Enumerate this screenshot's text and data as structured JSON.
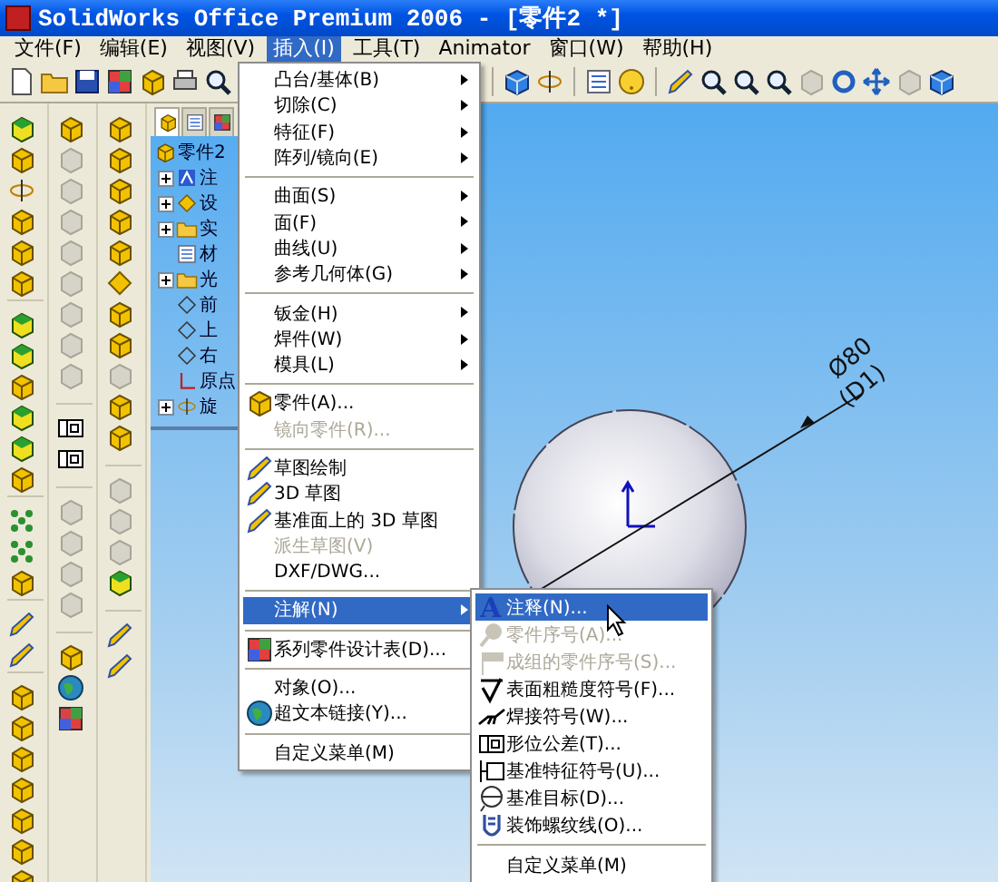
{
  "window": {
    "title": "SolidWorks Office Premium 2006 - [零件2 *]"
  },
  "menu_bar": [
    {
      "label": "文件(F)",
      "selected": false
    },
    {
      "label": "编辑(E)",
      "selected": false
    },
    {
      "label": "视图(V)",
      "selected": false
    },
    {
      "label": "插入(I)",
      "selected": true
    },
    {
      "label": "工具(T)",
      "selected": false
    },
    {
      "label": "Animator",
      "selected": false
    },
    {
      "label": "窗口(W)",
      "selected": false
    },
    {
      "label": "帮助(H)",
      "selected": false
    }
  ],
  "tree": {
    "tabs": [
      {
        "selected": true
      },
      {
        "selected": false
      },
      {
        "selected": false
      }
    ],
    "root": {
      "label": "零件2",
      "children": [
        {
          "label": "注",
          "expandable": true
        },
        {
          "label": "设",
          "expandable": true
        },
        {
          "label": "实",
          "expandable": true
        },
        {
          "label": "材",
          "expandable": false
        },
        {
          "label": "光",
          "expandable": true
        },
        {
          "label": "前",
          "expandable": false
        },
        {
          "label": "上",
          "expandable": false
        },
        {
          "label": "右",
          "expandable": false
        },
        {
          "label": "原点",
          "expandable": false
        },
        {
          "label": "旋",
          "expandable": true
        }
      ]
    }
  },
  "graphics": {
    "dimension": {
      "value": "Ø80",
      "name": "(D1)"
    }
  },
  "insert_menu": {
    "groups": [
      [
        {
          "label": "凸台/基体(B)",
          "submenu": true,
          "disabled": false,
          "selected": false
        },
        {
          "label": "切除(C)",
          "submenu": true,
          "disabled": false,
          "selected": false
        },
        {
          "label": "特征(F)",
          "submenu": true,
          "disabled": false,
          "selected": false
        },
        {
          "label": "阵列/镜向(E)",
          "submenu": true,
          "disabled": false,
          "selected": false
        }
      ],
      [
        {
          "label": "曲面(S)",
          "submenu": true,
          "disabled": false,
          "selected": false
        },
        {
          "label": "面(F)",
          "submenu": true,
          "disabled": false,
          "selected": false
        },
        {
          "label": "曲线(U)",
          "submenu": true,
          "disabled": false,
          "selected": false
        },
        {
          "label": "参考几何体(G)",
          "submenu": true,
          "disabled": false,
          "selected": false
        }
      ],
      [
        {
          "label": "钣金(H)",
          "submenu": true,
          "disabled": false,
          "selected": false
        },
        {
          "label": "焊件(W)",
          "submenu": true,
          "disabled": false,
          "selected": false
        },
        {
          "label": "模具(L)",
          "submenu": true,
          "disabled": false,
          "selected": false
        }
      ],
      [
        {
          "label": "零件(A)...",
          "submenu": false,
          "disabled": false,
          "selected": false
        },
        {
          "label": "镜向零件(R)...",
          "submenu": false,
          "disabled": true,
          "selected": false
        }
      ],
      [
        {
          "label": "草图绘制",
          "submenu": false,
          "disabled": false,
          "selected": false
        },
        {
          "label": "3D 草图",
          "submenu": false,
          "disabled": false,
          "selected": false
        },
        {
          "label": "基准面上的 3D 草图",
          "submenu": false,
          "disabled": false,
          "selected": false
        },
        {
          "label": "派生草图(V)",
          "submenu": false,
          "disabled": true,
          "selected": false
        },
        {
          "label": "DXF/DWG...",
          "submenu": false,
          "disabled": false,
          "selected": false
        }
      ],
      [
        {
          "label": "注解(N)",
          "submenu": true,
          "disabled": false,
          "selected": true
        }
      ],
      [
        {
          "label": "系列零件设计表(D)...",
          "submenu": false,
          "disabled": false,
          "selected": false
        }
      ],
      [
        {
          "label": "对象(O)...",
          "submenu": false,
          "disabled": false,
          "selected": false
        },
        {
          "label": "超文本链接(Y)...",
          "submenu": false,
          "disabled": false,
          "selected": false
        }
      ],
      [
        {
          "label": "自定义菜单(M)",
          "submenu": false,
          "disabled": false,
          "selected": false
        }
      ]
    ]
  },
  "annotation_submenu": {
    "groups": [
      [
        {
          "label": "注释(N)...",
          "icon_text": "A",
          "disabled": false,
          "selected": true
        },
        {
          "label": "零件序号(A)...",
          "disabled": true,
          "selected": false
        },
        {
          "label": "成组的零件序号(S)...",
          "disabled": true,
          "selected": false
        },
        {
          "label": "表面粗糙度符号(F)...",
          "disabled": false,
          "selected": false
        },
        {
          "label": "焊接符号(W)...",
          "disabled": false,
          "selected": false
        },
        {
          "label": "形位公差(T)...",
          "disabled": false,
          "selected": false
        },
        {
          "label": "基准特征符号(U)...",
          "disabled": false,
          "selected": false
        },
        {
          "label": "基准目标(D)...",
          "disabled": false,
          "selected": false
        },
        {
          "label": "装饰螺纹线(O)...",
          "disabled": false,
          "selected": false
        }
      ],
      [
        {
          "label": "自定义菜单(M)",
          "disabled": false,
          "selected": false
        }
      ]
    ]
  }
}
